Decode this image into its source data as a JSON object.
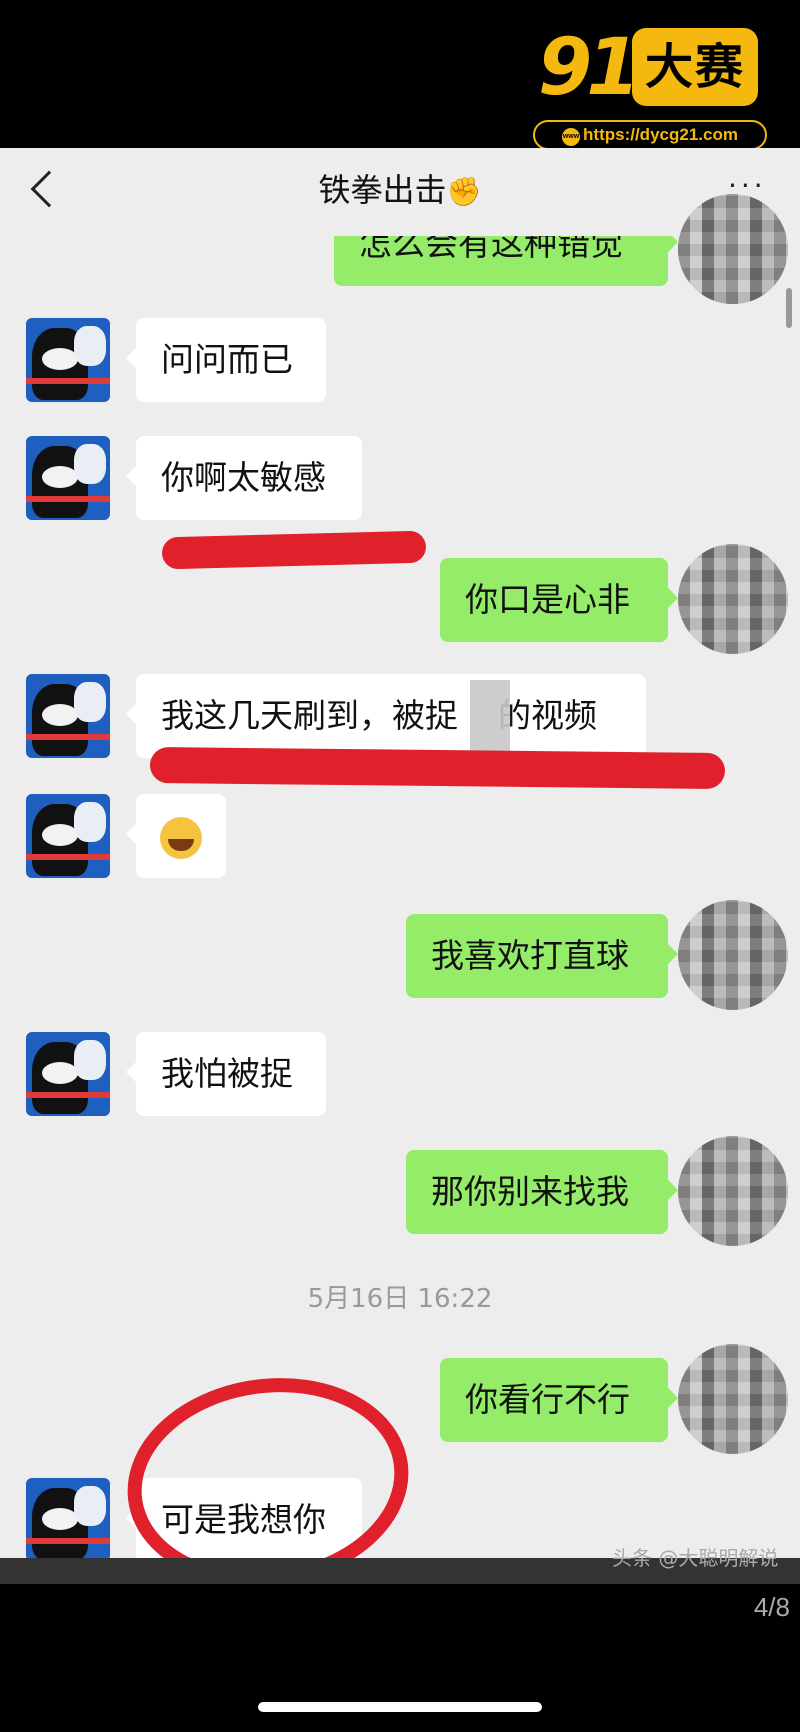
{
  "watermark": {
    "logo_number": "91",
    "logo_badge": "大赛",
    "url_prefix": "www",
    "url": "https://dycg21.com"
  },
  "header": {
    "title": "铁拳出击",
    "title_icon": "fist-icon"
  },
  "messages": [
    {
      "side": "right",
      "text": "怎么会有这种错觉"
    },
    {
      "side": "left",
      "text": "问问而已"
    },
    {
      "side": "left",
      "text": "你啊太敏感"
    },
    {
      "side": "right",
      "text": "你口是心非"
    },
    {
      "side": "left",
      "text": "我这几天刷到，被捉",
      "text_after": "的视频"
    },
    {
      "side": "left",
      "text": "",
      "icon": "laughing-tears-emoji"
    },
    {
      "side": "right",
      "text": "我喜欢打直球"
    },
    {
      "side": "left",
      "text": "我怕被捉"
    },
    {
      "side": "right",
      "text": "那你别来找我"
    },
    {
      "side": "right",
      "text": "你看行不行"
    },
    {
      "side": "left",
      "text": "可是我想你"
    }
  ],
  "timestamp": "5月16日 16:22",
  "credit": "头条 @大聪明解说",
  "page_indicator": "4/8",
  "colors": {
    "chat_background": "#ededed",
    "right_bubble": "#95ec69",
    "left_bubble": "#ffffff",
    "annotation_red": "#e0202a",
    "watermark_gold": "#f5b80f"
  }
}
